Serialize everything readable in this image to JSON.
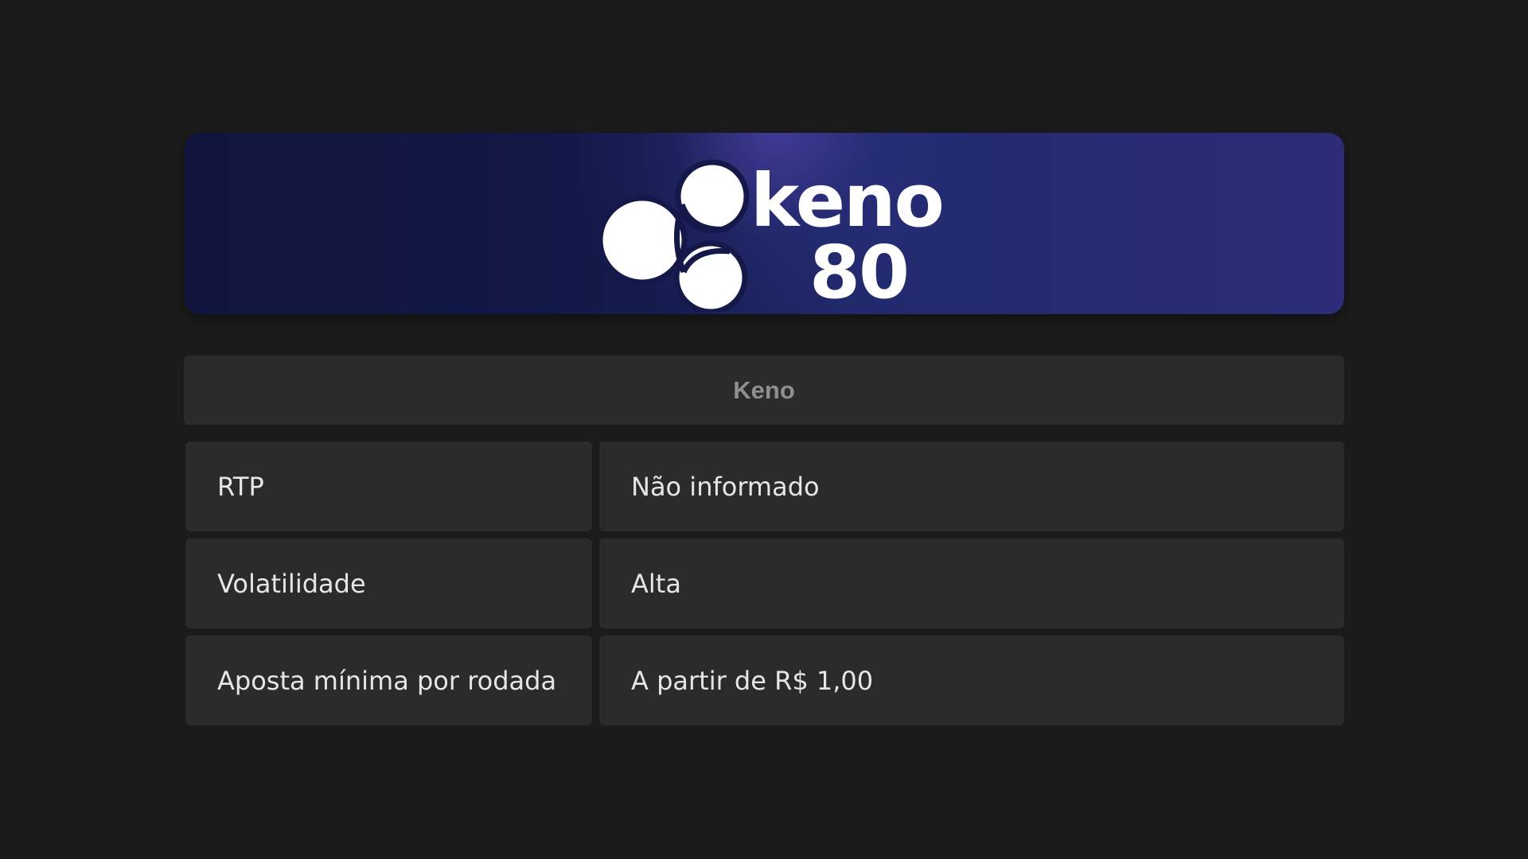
{
  "banner": {
    "logo_word": "keno",
    "logo_number": "80",
    "logo_icon": "keno-rings-logo-icon"
  },
  "game": {
    "title": "Keno"
  },
  "info": [
    {
      "label": "RTP",
      "value": "Não informado"
    },
    {
      "label": "Volatilidade",
      "value": "Alta"
    },
    {
      "label": "Aposta mínima por rodada",
      "value": "A partir de R$ 1,00"
    }
  ],
  "colors": {
    "background": "#1b1b1b",
    "card": "#2b2b2b",
    "banner_left": "#10153d",
    "banner_right": "#2c2c78",
    "title_text": "#8f8f8f",
    "cell_text": "#e6e6e6"
  }
}
